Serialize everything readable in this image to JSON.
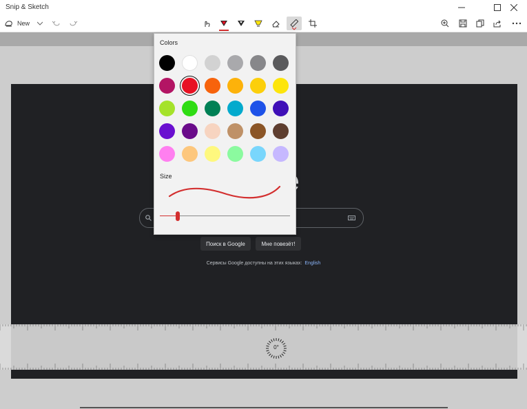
{
  "window": {
    "title": "Snip & Sketch"
  },
  "toolbar": {
    "new_label": "New"
  },
  "colors_panel": {
    "colors_label": "Colors",
    "size_label": "Size",
    "selected_color": "#e81123",
    "swatches": [
      "#000000",
      "#ffffff",
      "#d2d2d2",
      "#a9a9ac",
      "#87878a",
      "#5a5a5c",
      "#b31564",
      "#e81123",
      "#f7630c",
      "#fdb20a",
      "#fccf0b",
      "#fde50b",
      "#a5e22a",
      "#2fdc13",
      "#008055",
      "#03aacd",
      "#1e52e8",
      "#3f0fb7",
      "#6a0fd0",
      "#6a0b8a",
      "#f7d4c0",
      "#bf9167",
      "#8b5526",
      "#5e3e2f",
      "#ff7ff0",
      "#fdc77d",
      "#fef87e",
      "#8bfa9f",
      "#79d6fc",
      "#c6b8ff"
    ],
    "size_value": 0.14
  },
  "page": {
    "search_button": "Поиск в Google",
    "lucky_button": "Мне повезёт!",
    "languages_text": "Сервисы Google доступны на этих языках:",
    "language_link": "English",
    "logo_fragment": "e"
  },
  "ruler": {
    "angle": "0°"
  }
}
